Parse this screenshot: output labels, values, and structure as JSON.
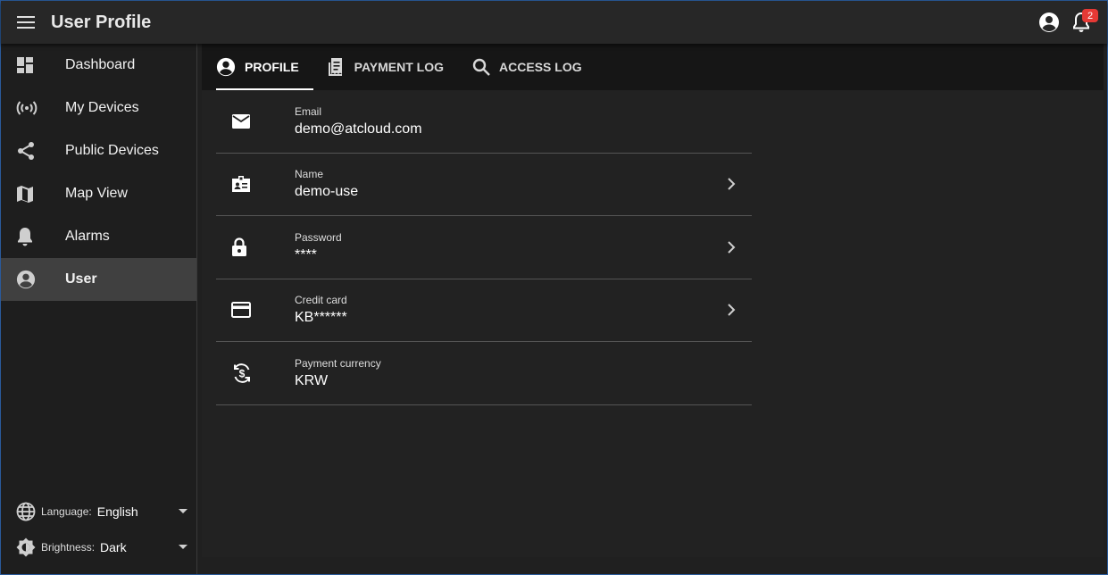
{
  "app": {
    "title": "User Profile",
    "notification_count": "2"
  },
  "sidebar": {
    "items": [
      {
        "label": "Dashboard",
        "icon": "dashboard-icon"
      },
      {
        "label": "My Devices",
        "icon": "broadcast-icon"
      },
      {
        "label": "Public Devices",
        "icon": "share-icon"
      },
      {
        "label": "Map View",
        "icon": "map-icon"
      },
      {
        "label": "Alarms",
        "icon": "bell-icon"
      },
      {
        "label": "User",
        "icon": "account-circle-icon"
      }
    ],
    "active_index": 5,
    "language": {
      "label": "Language:",
      "value": "English"
    },
    "brightness": {
      "label": "Brightness:",
      "value": "Dark"
    }
  },
  "tabs": [
    {
      "label": "PROFILE",
      "icon": "account-circle-icon"
    },
    {
      "label": "PAYMENT LOG",
      "icon": "receipt-icon"
    },
    {
      "label": "ACCESS LOG",
      "icon": "search-icon"
    }
  ],
  "profile": {
    "email": {
      "label": "Email",
      "value": "demo@atcloud.com"
    },
    "name": {
      "label": "Name",
      "value": "demo-use"
    },
    "password": {
      "label": "Password",
      "value": "****"
    },
    "credit_card": {
      "label": "Credit card",
      "value": "KB******"
    },
    "currency": {
      "label": "Payment currency",
      "value": "KRW"
    }
  },
  "colors": {
    "background": "#202020",
    "appbar": "#272727",
    "active_nav": "#404040",
    "badge": "#e53935"
  }
}
